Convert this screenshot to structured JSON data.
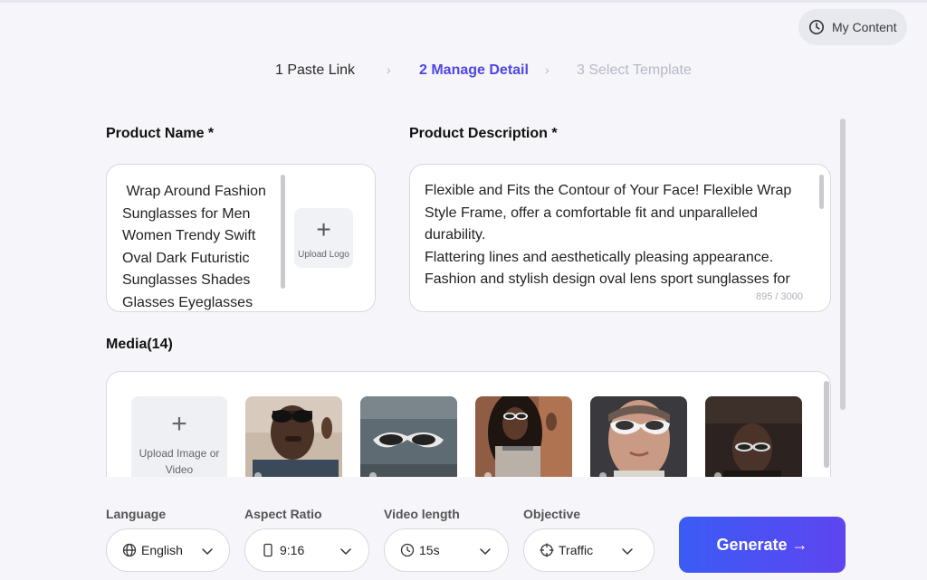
{
  "header": {
    "my_content_label": "My Content"
  },
  "steps": [
    {
      "label": "1 Paste Link",
      "state": "done"
    },
    {
      "label": "2 Manage Detail",
      "state": "active"
    },
    {
      "label": "3 Select Template",
      "state": "pending"
    }
  ],
  "product_name": {
    "label": "Product Name *",
    "value": " Wrap Around Fashion\nSunglasses for Men\nWomen Trendy Swift\nOval Dark Futuristic\nSunglasses Shades\nGlasses Eyeglasses",
    "upload_logo_label": "Upload Logo"
  },
  "product_description": {
    "label": "Product Description *",
    "lines": [
      "Flexible and Fits the Contour of Your Face! Flexible Wrap",
      "Style Frame, offer a comfortable fit and unparalleled",
      "durability.",
      "Flattering lines and aesthetically pleasing appearance.",
      "Fashion and stylish design oval lens sport sunglasses for"
    ],
    "char_count": "895 / 3000"
  },
  "media": {
    "label": "Media(14)",
    "upload_label": "Upload Image or Video"
  },
  "settings": {
    "language": {
      "label": "Language",
      "value": "English"
    },
    "aspect_ratio": {
      "label": "Aspect Ratio",
      "value": "9:16"
    },
    "video_length": {
      "label": "Video length",
      "value": "15s"
    },
    "objective": {
      "label": "Objective",
      "value": "Traffic"
    }
  },
  "generate_label": "Generate →",
  "colors": {
    "accent": "#4f46e5",
    "button_start": "#3b5bf5",
    "button_end": "#5e45f0"
  }
}
